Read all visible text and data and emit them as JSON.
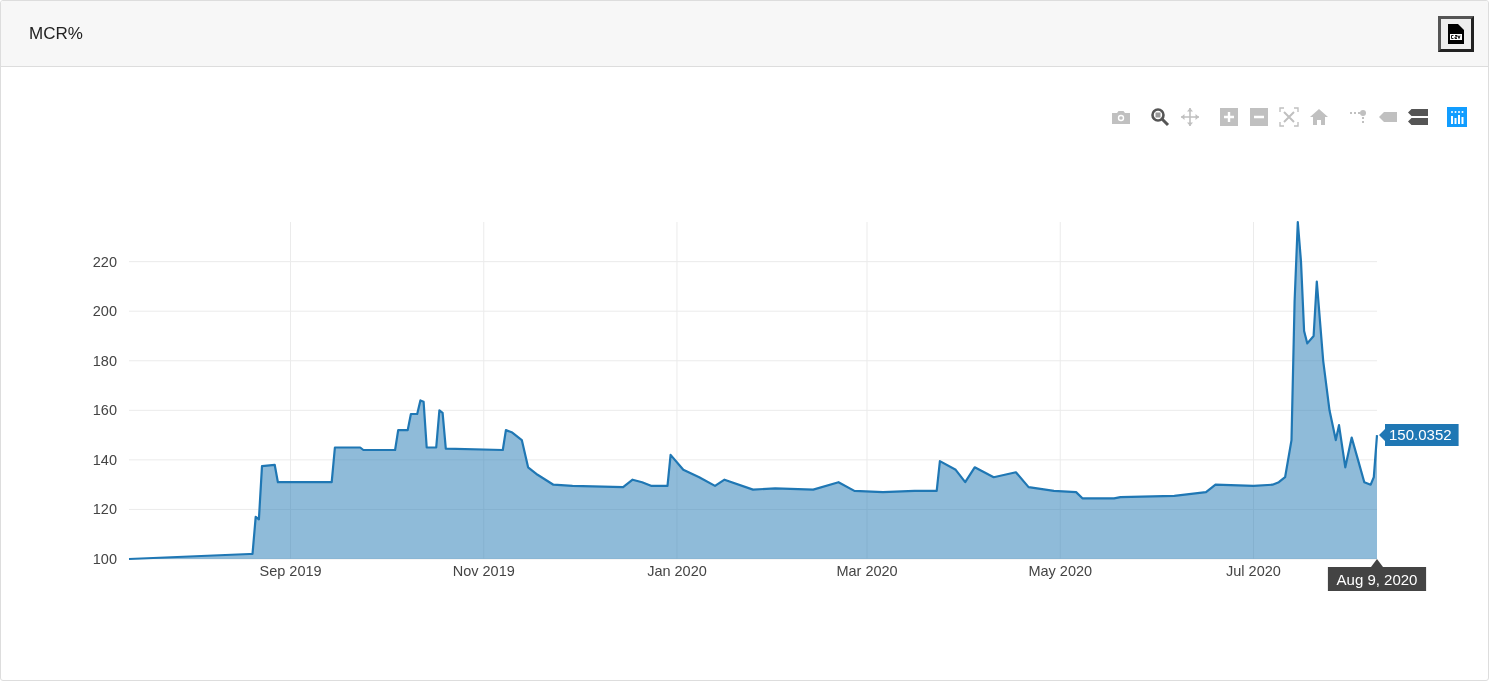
{
  "panel": {
    "title": "MCR%"
  },
  "modebar": [
    [
      {
        "kind": "camera",
        "selected": false
      }
    ],
    [
      {
        "kind": "zoom",
        "selected": true
      },
      {
        "kind": "pan",
        "selected": false
      }
    ],
    [
      {
        "kind": "zoom-in",
        "selected": false
      },
      {
        "kind": "zoom-out",
        "selected": false
      },
      {
        "kind": "autoscale",
        "selected": false
      },
      {
        "kind": "home",
        "selected": false
      }
    ],
    [
      {
        "kind": "spikelines",
        "selected": false
      },
      {
        "kind": "hover-closest",
        "selected": false
      },
      {
        "kind": "hover-compare",
        "selected": true
      }
    ]
  ],
  "chart_data": {
    "type": "area",
    "xlim": [
      "2019-07-12",
      "2020-08-09"
    ],
    "ylim": [
      100,
      236
    ],
    "xticks": [
      {
        "value": "2019-09-01",
        "label": "Sep 2019"
      },
      {
        "value": "2019-11-01",
        "label": "Nov 2019"
      },
      {
        "value": "2020-01-01",
        "label": "Jan 2020"
      },
      {
        "value": "2020-03-01",
        "label": "Mar 2020"
      },
      {
        "value": "2020-05-01",
        "label": "May 2020"
      },
      {
        "value": "2020-07-01",
        "label": "Jul 2020"
      }
    ],
    "yticks": [
      100,
      120,
      140,
      160,
      180,
      200,
      220
    ],
    "x": [
      "2019-07-12",
      "2019-08-19",
      "2019-08-20",
      "2019-08-21",
      "2019-08-22",
      "2019-08-23",
      "2019-08-27",
      "2019-08-28",
      "2019-09-14",
      "2019-09-15",
      "2019-09-23",
      "2019-09-24",
      "2019-10-04",
      "2019-10-05",
      "2019-10-08",
      "2019-10-09",
      "2019-10-11",
      "2019-10-12",
      "2019-10-13",
      "2019-10-14",
      "2019-10-17",
      "2019-10-18",
      "2019-10-19",
      "2019-10-20",
      "2019-11-07",
      "2019-11-08",
      "2019-11-10",
      "2019-11-13",
      "2019-11-15",
      "2019-11-18",
      "2019-11-23",
      "2019-11-29",
      "2019-12-15",
      "2019-12-18",
      "2019-12-21",
      "2019-12-24",
      "2019-12-29",
      "2019-12-30",
      "2020-01-03",
      "2020-01-08",
      "2020-01-13",
      "2020-01-16",
      "2020-01-25",
      "2020-02-01",
      "2020-02-13",
      "2020-02-21",
      "2020-02-26",
      "2020-03-06",
      "2020-03-16",
      "2020-03-23",
      "2020-03-24",
      "2020-03-29",
      "2020-04-01",
      "2020-04-04",
      "2020-04-10",
      "2020-04-17",
      "2020-04-21",
      "2020-04-29",
      "2020-05-06",
      "2020-05-08",
      "2020-05-18",
      "2020-05-20",
      "2020-06-06",
      "2020-06-16",
      "2020-06-19",
      "2020-07-01",
      "2020-07-07",
      "2020-07-09",
      "2020-07-11",
      "2020-07-13",
      "2020-07-14",
      "2020-07-15",
      "2020-07-16",
      "2020-07-17",
      "2020-07-18",
      "2020-07-20",
      "2020-07-21",
      "2020-07-23",
      "2020-07-25",
      "2020-07-27",
      "2020-07-28",
      "2020-07-30",
      "2020-08-01",
      "2020-08-03",
      "2020-08-05",
      "2020-08-07",
      "2020-08-08",
      "2020-08-09"
    ],
    "series": [
      {
        "color": "#1f77b4",
        "values": [
          100,
          102,
          102,
          117,
          116,
          137.5,
          138,
          131,
          131,
          145,
          145,
          144,
          144,
          152,
          152,
          158.5,
          158.5,
          164,
          163.5,
          145,
          145,
          160,
          159,
          144.5,
          144,
          152,
          151,
          148,
          137,
          134,
          130,
          129.5,
          129,
          132,
          131,
          129.5,
          129.5,
          142,
          136,
          133,
          129.5,
          132,
          128,
          128.5,
          128,
          131,
          127.5,
          127,
          127.5,
          127.5,
          139.5,
          136,
          131,
          137,
          133,
          135,
          129,
          127.5,
          127,
          124.5,
          124.5,
          125,
          125.5,
          127,
          130,
          129.5,
          130,
          131,
          133,
          148,
          204,
          236,
          220,
          192,
          187,
          190,
          212,
          180,
          160,
          148,
          154,
          137,
          149,
          140,
          131,
          130,
          133,
          150
        ]
      }
    ],
    "grid": true,
    "annotations": [
      {
        "x": "2020-08-09",
        "y": 150,
        "text": "150.0352"
      },
      "Aug 9, 2020"
    ]
  }
}
